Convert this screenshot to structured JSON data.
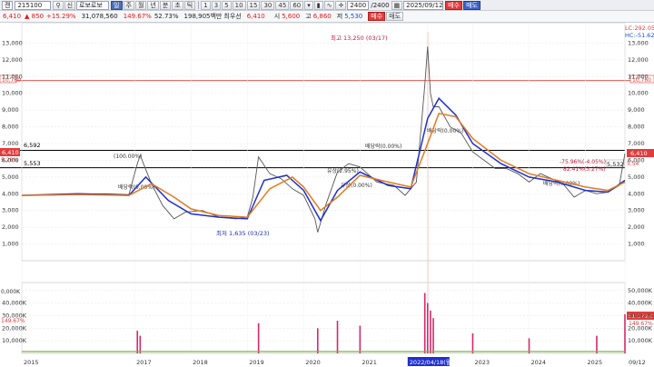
{
  "toolbar": {
    "period_label": "캔",
    "code": "215100",
    "stock_name": "로보로보",
    "info_label": "신",
    "period_buttons": [
      "주",
      "월",
      "년",
      "분",
      "초",
      "틱"
    ],
    "number_buttons": [
      "1",
      "3",
      "5",
      "10",
      "15",
      "30",
      "45",
      "60"
    ],
    "range_value": "2400",
    "range_total": "/2400",
    "date": "2025/09/12",
    "buy_label": "매수",
    "sell_label": "매도"
  },
  "quote": {
    "price": "6,410",
    "change": "▲ 850",
    "change_pct": "+15.29%",
    "volume": "31,078,560",
    "volume_pct": "149.67%",
    "turnover_ratio": "52.73%",
    "trade_value": "198,905백만",
    "fund_label": "최우선",
    "current": "6,410",
    "open_label": "시",
    "open": "5,600",
    "high_label": "고",
    "high": "6,860",
    "low_label": "저",
    "low": "5,530"
  },
  "chart_data": {
    "type": "line",
    "price_axis": {
      "ylim": [
        0,
        14000
      ],
      "ticks": [
        "1,000",
        "2,000",
        "3,000",
        "4,000",
        "5,000",
        "6,000",
        "7,000",
        "8,000",
        "9,000",
        "10,000",
        "11,000",
        "12,000",
        "13,000"
      ]
    },
    "volume_axis": {
      "ticks": [
        "10,000K",
        "20,000K",
        "30,000K",
        "40,000K",
        "50,000K"
      ],
      "left_label_top": "0,000K"
    },
    "x_ticks": [
      "2015",
      "2017",
      "2018",
      "2019",
      "2020",
      "2021",
      "2022/04/18(월)",
      "2023",
      "2024",
      "2025",
      "09/12"
    ],
    "lines": {
      "high_line": {
        "value": "10,760",
        "color": "#e23b3b"
      },
      "line_a": {
        "value": "6,592",
        "color": "#000000"
      },
      "line_b": {
        "value": "5,553",
        "color": "#000000"
      }
    },
    "right_labels": {
      "lc": "LC:292.05",
      "hc": "HC:-51.62",
      "price_tag": "6,410",
      "price_tag_2": "5,532",
      "price_tag_3": "5,54",
      "vol_tag": "31,079K",
      "vol_pct": "149.67%"
    },
    "left_labels": {
      "price_tag": "6,410",
      "price_pct": "5.26%",
      "vol_pct": "149.67%"
    },
    "annotations": {
      "max": "최고 13,250 (03/17)",
      "min": "최저 1,635 (03/23)",
      "sell_note": "배당락(0.00%)",
      "buyback_1": "(100.00%)",
      "note_a": "배당락(0.00%)",
      "note_b": "유상(2.95%)",
      "note_c": "유상(0.00%)",
      "note_d": "배당락(0.00%)",
      "note_e": "배당락(0.00%)",
      "right_1": "-75.96%(-4.05%)",
      "right_2": "82.41%(3.27%)"
    },
    "series": [
      {
        "name": "price",
        "color": "#555555",
        "x": [
          2015.0,
          2015.5,
          2016.0,
          2016.5,
          2016.9,
          2017.05,
          2017.1,
          2017.3,
          2017.5,
          2017.7,
          2017.9,
          2018.2,
          2018.5,
          2018.8,
          2019.0,
          2019.1,
          2019.2,
          2019.4,
          2019.6,
          2019.8,
          2020.0,
          2020.2,
          2020.25,
          2020.4,
          2020.6,
          2020.8,
          2021.0,
          2021.3,
          2021.6,
          2021.8,
          2022.0,
          2022.15,
          2022.2,
          2022.25,
          2022.3,
          2022.4,
          2022.6,
          2022.8,
          2023.0,
          2023.2,
          2023.4,
          2023.6,
          2023.8,
          2024.0,
          2024.2,
          2024.4,
          2024.6,
          2024.8,
          2025.0,
          2025.2,
          2025.4,
          2025.6,
          2025.7
        ],
        "values": [
          3900,
          3900,
          4000,
          4000,
          3950,
          5800,
          6300,
          4600,
          3300,
          2500,
          2900,
          3000,
          2600,
          2500,
          2600,
          3800,
          6200,
          5200,
          4900,
          4300,
          3900,
          2500,
          1700,
          3400,
          5300,
          5800,
          5600,
          4700,
          4500,
          3900,
          4700,
          10500,
          12800,
          10000,
          9200,
          9200,
          8000,
          7600,
          6500,
          6000,
          5500,
          5500,
          5200,
          4700,
          5200,
          4900,
          4600,
          3800,
          4200,
          4000,
          4100,
          4500,
          6400
        ]
      },
      {
        "name": "ma-blue",
        "color": "#1f2fd0",
        "x": [
          2015.0,
          2016.0,
          2016.9,
          2017.2,
          2017.6,
          2018.0,
          2018.5,
          2019.0,
          2019.3,
          2019.7,
          2020.0,
          2020.3,
          2020.6,
          2021.0,
          2021.5,
          2021.9,
          2022.2,
          2022.4,
          2022.7,
          2023.0,
          2023.5,
          2024.0,
          2024.5,
          2025.0,
          2025.4,
          2025.7
        ],
        "values": [
          3900,
          4000,
          3900,
          5000,
          3600,
          2800,
          2600,
          2500,
          4800,
          5100,
          4200,
          2400,
          4200,
          5300,
          4500,
          4300,
          8500,
          9700,
          8700,
          7000,
          5800,
          5000,
          4700,
          4200,
          4100,
          4800
        ]
      },
      {
        "name": "ma-orange",
        "color": "#e27a1e",
        "x": [
          2015.0,
          2016.0,
          2016.9,
          2017.3,
          2017.7,
          2018.0,
          2018.5,
          2019.0,
          2019.4,
          2019.8,
          2020.0,
          2020.3,
          2020.6,
          2021.0,
          2021.5,
          2021.9,
          2022.2,
          2022.4,
          2022.7,
          2023.0,
          2023.5,
          2024.0,
          2024.5,
          2025.0,
          2025.4,
          2025.7
        ],
        "values": [
          3900,
          3950,
          3900,
          4600,
          3800,
          3100,
          2700,
          2600,
          4300,
          5000,
          4400,
          3000,
          3800,
          5100,
          4700,
          4400,
          7000,
          8800,
          8600,
          7300,
          6000,
          5200,
          4800,
          4400,
          4200,
          4700
        ]
      }
    ],
    "volume_series": {
      "x": [
        2017.05,
        2017.1,
        2019.2,
        2020.25,
        2020.6,
        2021.0,
        2022.15,
        2022.2,
        2022.25,
        2022.3,
        2023.0,
        2024.0,
        2025.2,
        2025.7
      ],
      "values": [
        18000,
        14000,
        24000,
        20000,
        26000,
        22000,
        48000,
        40000,
        34000,
        28000,
        16000,
        12000,
        14000,
        31079
      ]
    }
  }
}
